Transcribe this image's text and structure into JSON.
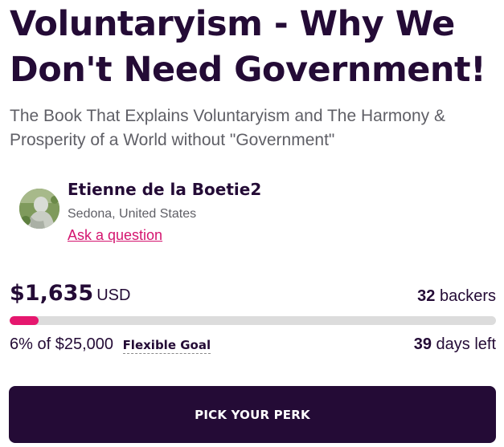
{
  "campaign": {
    "title": "Voluntaryism - Why We Don't Need Government!",
    "subtitle": "The Book That Explains Voluntaryism and The Harmony & Prosperity of a World without \"Government\""
  },
  "owner": {
    "name": "Etienne de la Boetie2",
    "location": "Sedona, United States",
    "ask_label": "Ask a question",
    "avatar_icon": "profile-photo"
  },
  "funding": {
    "raised_amount": "$1,635",
    "currency": "USD",
    "backers_count": "32",
    "backers_label": "backers",
    "percent_funded": 6,
    "goal_text": "6% of $25,000",
    "goal_type": "Flexible Goal",
    "days_left_count": "39",
    "days_left_label": "days left"
  },
  "cta": {
    "label": "PICK YOUR PERK"
  },
  "colors": {
    "primary": "#240b36",
    "accent": "#e5176e",
    "link": "#d4156f",
    "muted_text": "#5f5f66",
    "track": "#dcdcdc"
  }
}
